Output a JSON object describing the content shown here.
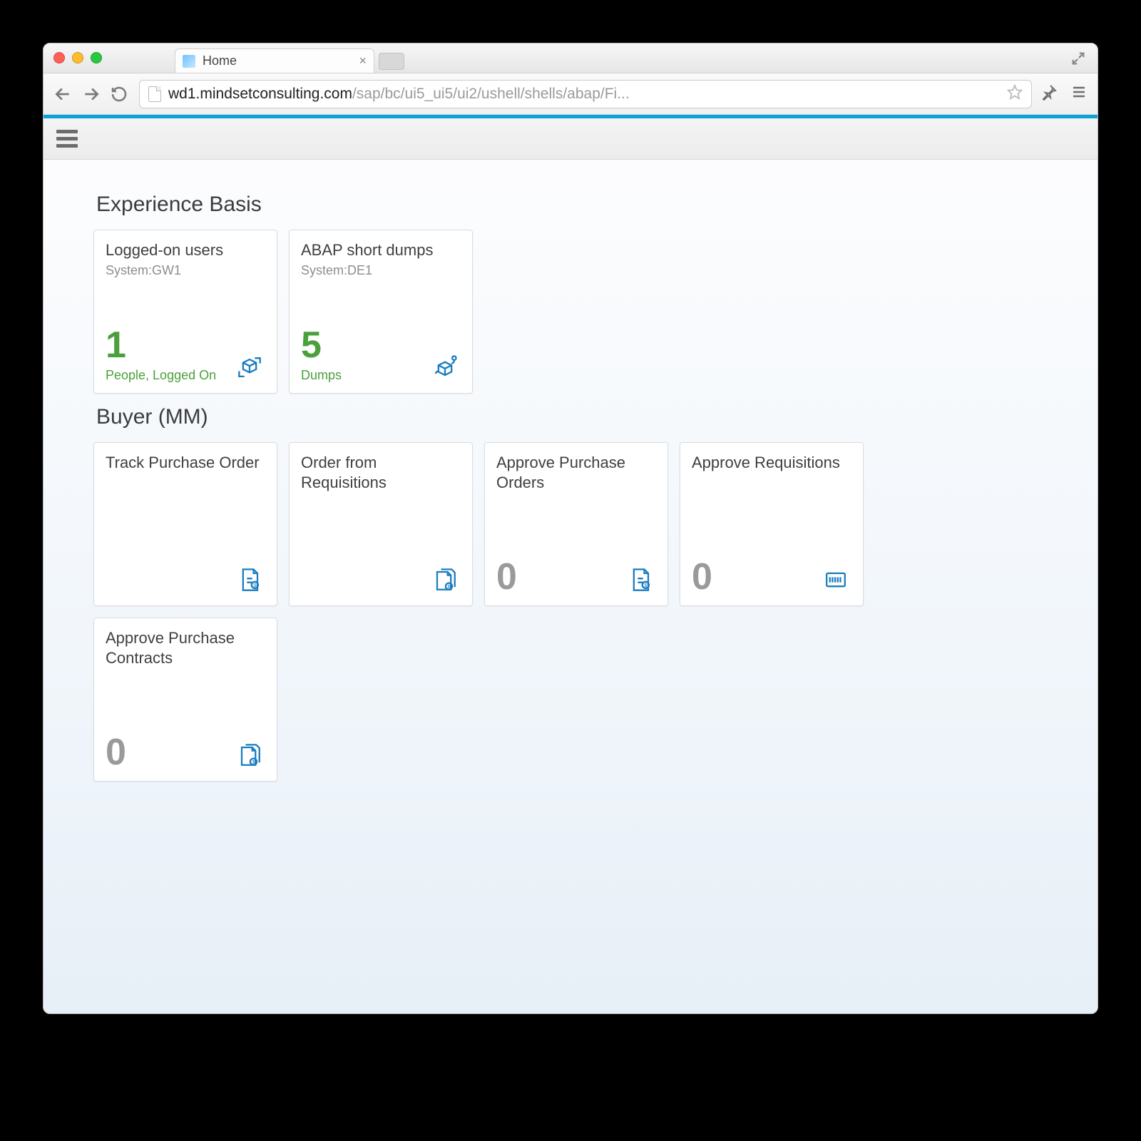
{
  "browser": {
    "tab_title": "Home",
    "url_host": "wd1.mindsetconsulting.com",
    "url_path": "/sap/bc/ui5_ui5/ui2/ushell/shells/abap/Fi..."
  },
  "groups": [
    {
      "title": "Experience Basis",
      "tiles": [
        {
          "title": "Logged-on users",
          "subtitle": "System:GW1",
          "kpi": "1",
          "kpi_color": "green",
          "unit": "People, Logged On",
          "icon": "box-refresh"
        },
        {
          "title": "ABAP short dumps",
          "subtitle": "System:DE1",
          "kpi": "5",
          "kpi_color": "green",
          "unit": "Dumps",
          "icon": "box-inspect"
        }
      ]
    },
    {
      "title": "Buyer (MM)",
      "tiles": [
        {
          "title": "Track Purchase Order",
          "subtitle": "",
          "kpi": "",
          "kpi_color": "",
          "unit": "",
          "icon": "doc-dollar"
        },
        {
          "title": "Order from Requisitions",
          "subtitle": "",
          "kpi": "",
          "kpi_color": "",
          "unit": "",
          "icon": "docs-dollar"
        },
        {
          "title": "Approve Purchase Orders",
          "subtitle": "",
          "kpi": "0",
          "kpi_color": "gray",
          "unit": "",
          "icon": "doc-dollar"
        },
        {
          "title": "Approve Requisitions",
          "subtitle": "",
          "kpi": "0",
          "kpi_color": "gray",
          "unit": "",
          "icon": "barcode"
        },
        {
          "title": "Approve Purchase Contracts",
          "subtitle": "",
          "kpi": "0",
          "kpi_color": "gray",
          "unit": "",
          "icon": "docs-dollar"
        }
      ]
    }
  ]
}
